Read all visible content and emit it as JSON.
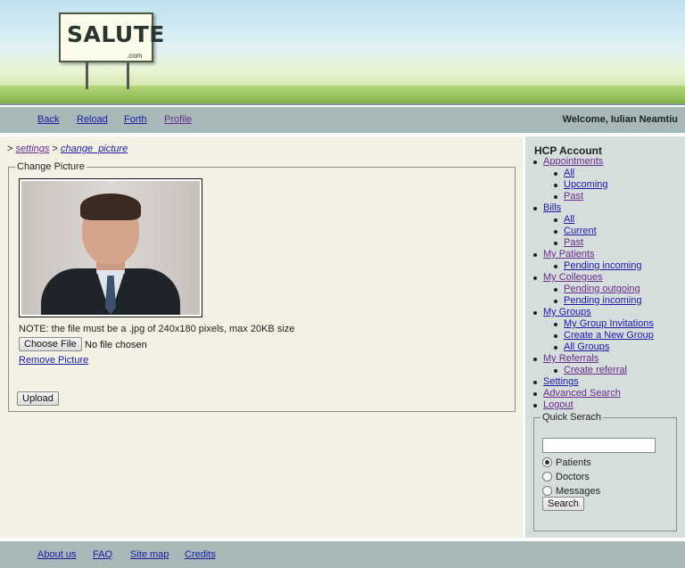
{
  "banner": {
    "logo_text": "SALUTE",
    "logo_sub": ".com"
  },
  "nav": {
    "back": "Back",
    "reload": "Reload",
    "forth": "Forth",
    "profile": "Profile",
    "welcome": "Welcome, Iulian Neamtiu"
  },
  "breadcrumb": {
    "sep1": ">",
    "settings": "settings",
    "sep2": ">",
    "change_picture": "change_picture"
  },
  "change_picture": {
    "legend": "Change Picture",
    "note": "NOTE: the file must be a .jpg of 240x180 pixels, max 20KB size",
    "choose_file": "Choose File",
    "no_file": "No file chosen",
    "remove_picture": "Remove Picture",
    "upload": "Upload"
  },
  "sidebar": {
    "title": "HCP Account",
    "items": [
      {
        "label": "Appointments",
        "level": 1,
        "visited": true
      },
      {
        "label": "All",
        "level": 2,
        "visited": false
      },
      {
        "label": "Upcoming",
        "level": 2,
        "visited": false
      },
      {
        "label": "Past",
        "level": 2,
        "visited": true
      },
      {
        "label": "Bills",
        "level": 1,
        "visited": false
      },
      {
        "label": "All",
        "level": 2,
        "visited": false
      },
      {
        "label": "Current",
        "level": 2,
        "visited": false
      },
      {
        "label": "Past",
        "level": 2,
        "visited": true
      },
      {
        "label": "My Patients",
        "level": 1,
        "visited": true
      },
      {
        "label": "Pending incoming",
        "level": 2,
        "visited": false
      },
      {
        "label": "My Collegues",
        "level": 1,
        "visited": true
      },
      {
        "label": "Pending outgoing",
        "level": 2,
        "visited": true
      },
      {
        "label": "Pending incoming",
        "level": 2,
        "visited": false
      },
      {
        "label": "My Groups",
        "level": 1,
        "visited": false
      },
      {
        "label": "My Group Invitations",
        "level": 2,
        "visited": false
      },
      {
        "label": "Create a New Group",
        "level": 2,
        "visited": false
      },
      {
        "label": "All Groups",
        "level": 2,
        "visited": false
      },
      {
        "label": "My Referrals",
        "level": 1,
        "visited": true
      },
      {
        "label": "Create referral",
        "level": 2,
        "visited": true
      },
      {
        "label": "Settings",
        "level": 1,
        "visited": false
      },
      {
        "label": "Advanced Search",
        "level": 1,
        "visited": true
      },
      {
        "label": "Logout",
        "level": 1,
        "visited": true
      }
    ],
    "quick_search": {
      "legend": "Quick Serach",
      "input_value": "",
      "options": [
        "Patients",
        "Doctors",
        "Messages"
      ],
      "selected": "Patients",
      "button": "Search"
    }
  },
  "footer": {
    "about": "About us",
    "faq": "FAQ",
    "sitemap": "Site map",
    "credits": "Credits"
  },
  "colors": {
    "bar": "#a6b9b8",
    "content_bg": "#f2f1e4",
    "sidebar_bg": "#d5dddd",
    "link": "#1a1aa6",
    "visited_link": "#6a2a8a"
  }
}
